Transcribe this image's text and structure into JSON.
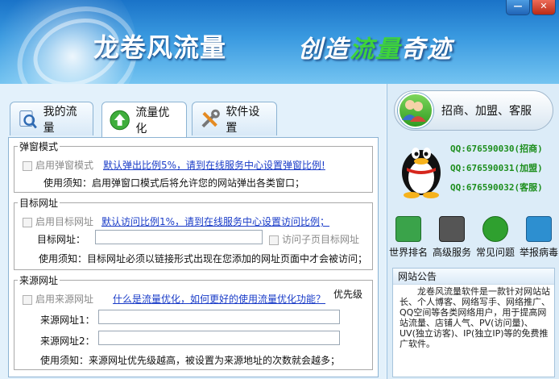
{
  "header": {
    "app_title": "龙卷风流量",
    "slogan_part1": "创造",
    "slogan_highlight": "流量",
    "slogan_part2": "奇迹",
    "min_btn": "—",
    "close_btn": "✕"
  },
  "tabs": [
    {
      "label": "我的流量",
      "icon": "search-doc-icon"
    },
    {
      "label": "流量优化",
      "icon": "arrow-up-circle-icon",
      "active": true
    },
    {
      "label": "软件设置",
      "icon": "tools-icon"
    }
  ],
  "popup_mode": {
    "legend": "弹窗模式",
    "checkbox_label": "启用弹窗模式",
    "link": "默认弹出比例5%，请到在线服务中心设置弹窗比例!",
    "note": "使用须知：启用弹窗口模式后将允许您的网站弹出各类窗口；"
  },
  "target_url": {
    "legend": "目标网址",
    "checkbox_label": "启用目标网址",
    "link": "默认访问比例1%，请到在线服务中心设置访问比例；",
    "field_label": "目标网址：",
    "field_value": "",
    "sub_checkbox_label": "访问子页目标网址",
    "note": "使用须知：目标网址必须以链接形式出现在您添加的网址页面中才会被访问；"
  },
  "source_url": {
    "legend": "来源网址",
    "checkbox_label": "启用来源网址",
    "link": "什么是流量优化，如何更好的使用流量优化功能？",
    "priority": "优先级",
    "field1_label": "来源网址1：",
    "field1_value": "",
    "field2_label": "来源网址2：",
    "field2_value": "",
    "note": "使用须知：来源网址优先级越高，被设置为来源地址的次数就会越多；"
  },
  "sidebar": {
    "contact_button": "招商、加盟、客服",
    "qq_lines": [
      "QQ:676590030(招商)",
      "QQ:676590031(加盟)",
      "QQ:676590032(客服)"
    ],
    "icons": [
      {
        "label": "世界排名",
        "icon": "world-rank-icon",
        "color": "#3aa34a"
      },
      {
        "label": "高级服务",
        "icon": "advanced-service-icon",
        "color": "#555555"
      },
      {
        "label": "常见问题",
        "icon": "faq-icon",
        "color": "#2fa02f"
      },
      {
        "label": "举报病毒",
        "icon": "report-virus-icon",
        "color": "#2d8fd0"
      }
    ],
    "notice_title": "网站公告",
    "notice_text": "　　龙卷风流量软件是一款针对网站站长、个人博客、网络写手、网络推广、QQ空间等各类网络用户，用于提高网站流量、店铺人气、PV(访问量)、UV(独立访客)、IP(独立IP)等的免费推广软件。"
  },
  "colors": {
    "accent": "#1a73c8",
    "link": "#1a3cc8",
    "qq_green": "#1d8e1d",
    "close_red": "#b92a15"
  }
}
